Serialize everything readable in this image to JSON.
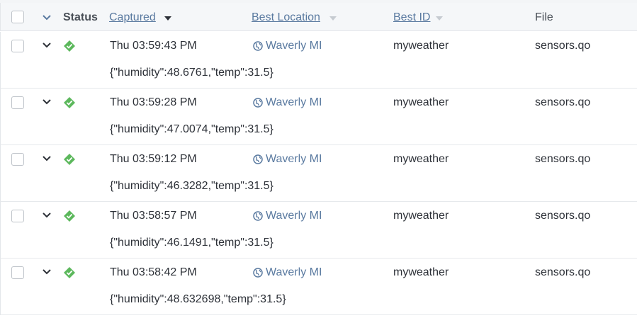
{
  "colors": {
    "accent_link": "#5a7aa0",
    "status_ok": "#5cb85c",
    "text": "#2d3138",
    "header_bg": "#f5f7f9"
  },
  "header": {
    "status": "Status",
    "captured": "Captured",
    "best_location": "Best Location",
    "best_id": "Best ID",
    "file": "File"
  },
  "rows": [
    {
      "captured": "Thu 03:59:43 PM",
      "location": "Waverly MI",
      "best_id": "myweather",
      "file": "sensors.qo",
      "body": "{\"humidity\":48.6761,\"temp\":31.5}",
      "status_icon": "check-diamond-icon"
    },
    {
      "captured": "Thu 03:59:28 PM",
      "location": "Waverly MI",
      "best_id": "myweather",
      "file": "sensors.qo",
      "body": "{\"humidity\":47.0074,\"temp\":31.5}",
      "status_icon": "check-diamond-icon"
    },
    {
      "captured": "Thu 03:59:12 PM",
      "location": "Waverly MI",
      "best_id": "myweather",
      "file": "sensors.qo",
      "body": "{\"humidity\":46.3282,\"temp\":31.5}",
      "status_icon": "check-diamond-icon"
    },
    {
      "captured": "Thu 03:58:57 PM",
      "location": "Waverly MI",
      "best_id": "myweather",
      "file": "sensors.qo",
      "body": "{\"humidity\":46.1491,\"temp\":31.5}",
      "status_icon": "check-diamond-icon"
    },
    {
      "captured": "Thu 03:58:42 PM",
      "location": "Waverly MI",
      "best_id": "myweather",
      "file": "sensors.qo",
      "body": "{\"humidity\":48.632698,\"temp\":31.5}",
      "status_icon": "check-diamond-icon"
    }
  ]
}
